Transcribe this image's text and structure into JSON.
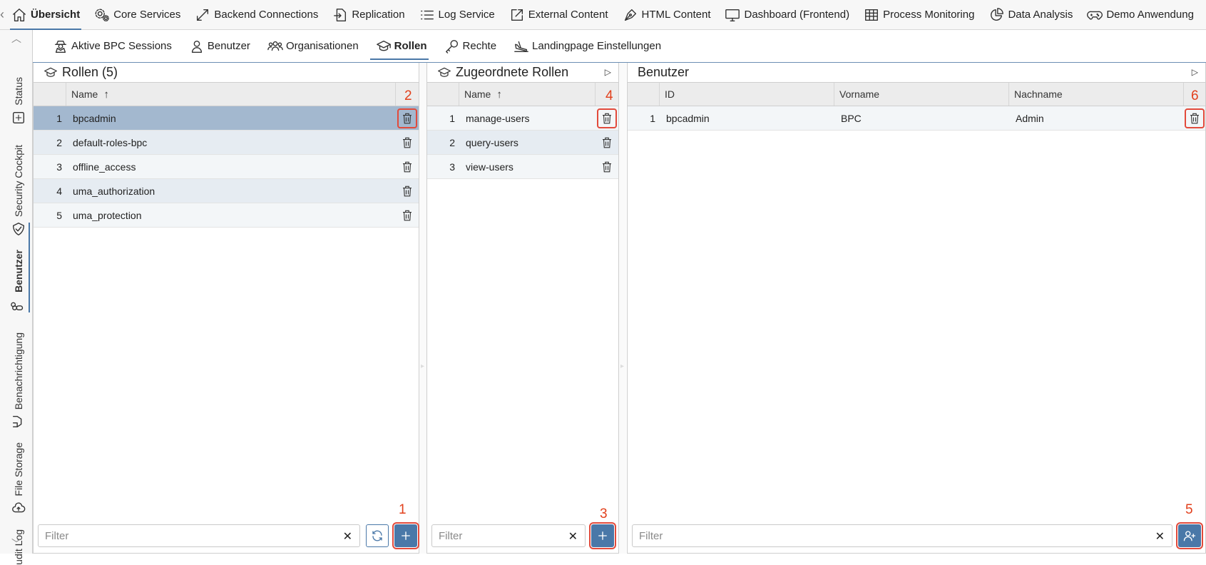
{
  "topnav": {
    "items": [
      {
        "label": "Übersicht",
        "icon": "home-icon",
        "active": true
      },
      {
        "label": "Core Services",
        "icon": "gears-icon"
      },
      {
        "label": "Backend Connections",
        "icon": "diagonal-arrows-icon"
      },
      {
        "label": "Replication",
        "icon": "file-import-icon"
      },
      {
        "label": "Log Service",
        "icon": "list-icon"
      },
      {
        "label": "External Content",
        "icon": "external-link-icon"
      },
      {
        "label": "HTML Content",
        "icon": "pen-nib-icon"
      },
      {
        "label": "Dashboard (Frontend)",
        "icon": "monitor-icon"
      },
      {
        "label": "Process Monitoring",
        "icon": "table-icon"
      },
      {
        "label": "Data Analysis",
        "icon": "pie-chart-icon"
      },
      {
        "label": "Demo Anwendung",
        "icon": "gamepad-icon"
      }
    ]
  },
  "sidebar": {
    "items": [
      {
        "label": "Status",
        "icon": "status-icon"
      },
      {
        "label": "Security Cockpit",
        "icon": "shield-icon"
      },
      {
        "label": "Benutzer",
        "icon": "users-icon",
        "active": true
      },
      {
        "label": "Benachrichtigung",
        "icon": "megaphone-icon"
      },
      {
        "label": "File Storage",
        "icon": "cloud-upload-icon"
      },
      {
        "label": "udit Log",
        "icon": "audit-icon"
      }
    ]
  },
  "subtabs": [
    {
      "label": "Aktive BPC Sessions",
      "icon": "user-secret-icon"
    },
    {
      "label": "Benutzer",
      "icon": "user-icon"
    },
    {
      "label": "Organisationen",
      "icon": "group-icon"
    },
    {
      "label": "Rollen",
      "icon": "graduation-cap-icon",
      "active": true
    },
    {
      "label": "Rechte",
      "icon": "key-icon"
    },
    {
      "label": "Landingpage Einstellungen",
      "icon": "plane-landing-icon"
    }
  ],
  "roles_panel": {
    "title": "Rollen (5)",
    "header": {
      "name": "Name"
    },
    "rows": [
      {
        "num": "1",
        "name": "bpcadmin"
      },
      {
        "num": "2",
        "name": "default-roles-bpc"
      },
      {
        "num": "3",
        "name": "offline_access"
      },
      {
        "num": "4",
        "name": "uma_authorization"
      },
      {
        "num": "5",
        "name": "uma_protection"
      }
    ],
    "filter_placeholder": "Filter",
    "markers": {
      "delete": "2",
      "add": "1"
    }
  },
  "assigned_panel": {
    "title": "Zugeordnete Rollen",
    "header": {
      "name": "Name"
    },
    "rows": [
      {
        "num": "1",
        "name": "manage-users"
      },
      {
        "num": "2",
        "name": "query-users"
      },
      {
        "num": "3",
        "name": "view-users"
      }
    ],
    "filter_placeholder": "Filter",
    "markers": {
      "delete": "4",
      "add": "3"
    }
  },
  "users_panel": {
    "title": "Benutzer",
    "header": {
      "id": "ID",
      "vorname": "Vorname",
      "nachname": "Nachname"
    },
    "rows": [
      {
        "num": "1",
        "id": "bpcadmin",
        "vorname": "BPC",
        "nachname": "Admin"
      }
    ],
    "filter_placeholder": "Filter",
    "markers": {
      "delete": "6",
      "add": "5"
    }
  },
  "colors": {
    "accent": "#4a78a8",
    "marker": "#e2401c",
    "selected_row": "#a3b8cf"
  }
}
